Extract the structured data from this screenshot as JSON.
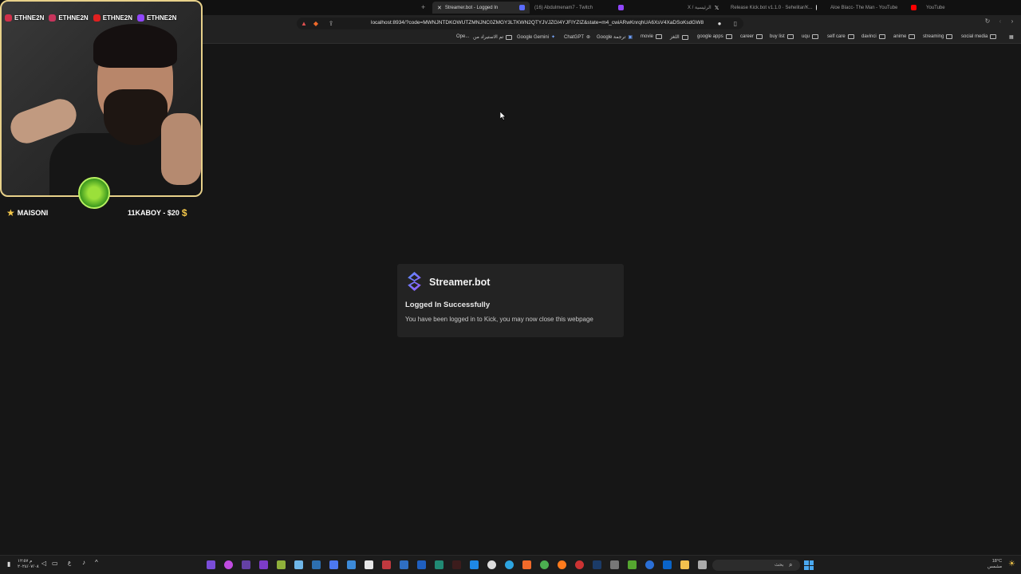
{
  "browser": {
    "tabs": [
      {
        "label": "Streamer.bot - Logged In",
        "active": true
      },
      {
        "label": "(16) Abdulmenam7 - Twitch",
        "active": false
      },
      {
        "label": "X / الرئيسية",
        "active": false
      },
      {
        "label": "Release Kick.bot v1.1.0 · Sehelitar/K...",
        "active": false
      },
      {
        "label": "Aloe Blacc- The Man - YouTube",
        "active": false
      },
      {
        "label": "YouTube",
        "active": false
      }
    ],
    "url": "localhost:8934/?code=MWNJNTDKOWUTZMNJNC0ZMGY3LTKWN2QTYJVJZGI4YJFIYZIZ&state=m4_cwiARwKnrqhUA6XsV4XaDSoKsdGW8",
    "bookmarks": [
      "Ope...",
      "تم الاستيراد من",
      "Google Gemini",
      "ChatGPT",
      "Google ترجمة",
      "movie",
      "اللغز",
      "google apps",
      "career",
      "buy list",
      "uqu",
      "self care",
      "davinci",
      "anime",
      "streaming",
      "social media"
    ]
  },
  "overlay": {
    "names": [
      "ETHNE2N",
      "ETHNE2N",
      "ETHNE2N",
      "ETHNE2N"
    ],
    "left_label": "MAISONI",
    "right_label": "11KABOY - $20"
  },
  "card": {
    "brand": "Streamer.bot",
    "title": "Logged In Successfully",
    "message": "You have been logged in to Kick, you may now close this webpage",
    "logo_colors": [
      "#5b8cff",
      "#9a5bff"
    ]
  },
  "taskbar": {
    "time": "م ١٢:٥٧",
    "date": "٢٠٢٤/٠٧/٠٨",
    "search_placeholder": "بحث",
    "weather_temp": "18°C",
    "weather_label": "مشمس"
  }
}
